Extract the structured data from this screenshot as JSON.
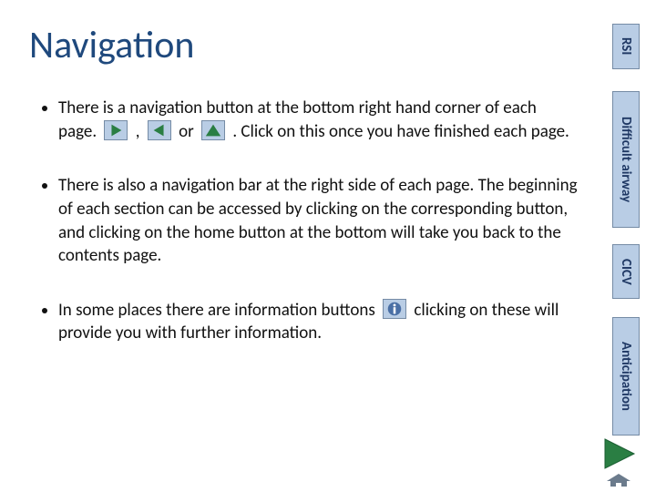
{
  "title": "Navigation",
  "tabs": {
    "rsi": {
      "label": "RSI"
    },
    "diff": {
      "label": "Difficult airway"
    },
    "cicv": {
      "label": "CICV"
    },
    "anti": {
      "label": "Anticipation"
    }
  },
  "bullets": {
    "b1a": "There is a navigation button at the bottom right hand corner of each page. ",
    "b1b": " , ",
    "b1c": " or ",
    "b1d": " . Click on this once you have finished each page.",
    "b2": "There is also a navigation bar at the right side of each page. The beginning of each section can be accessed by clicking on the corresponding button, and clicking on the home button at the bottom will take you back to the contents page.",
    "b3a": "In some places there are information buttons ",
    "b3b": " clicking on these will provide you with further information."
  },
  "icons": {
    "play_right": "play-right-icon",
    "play_left": "play-left-icon",
    "play_up": "play-up-icon",
    "info": "info-icon",
    "nav_next": "nav-next-icon",
    "home": "home-icon"
  }
}
